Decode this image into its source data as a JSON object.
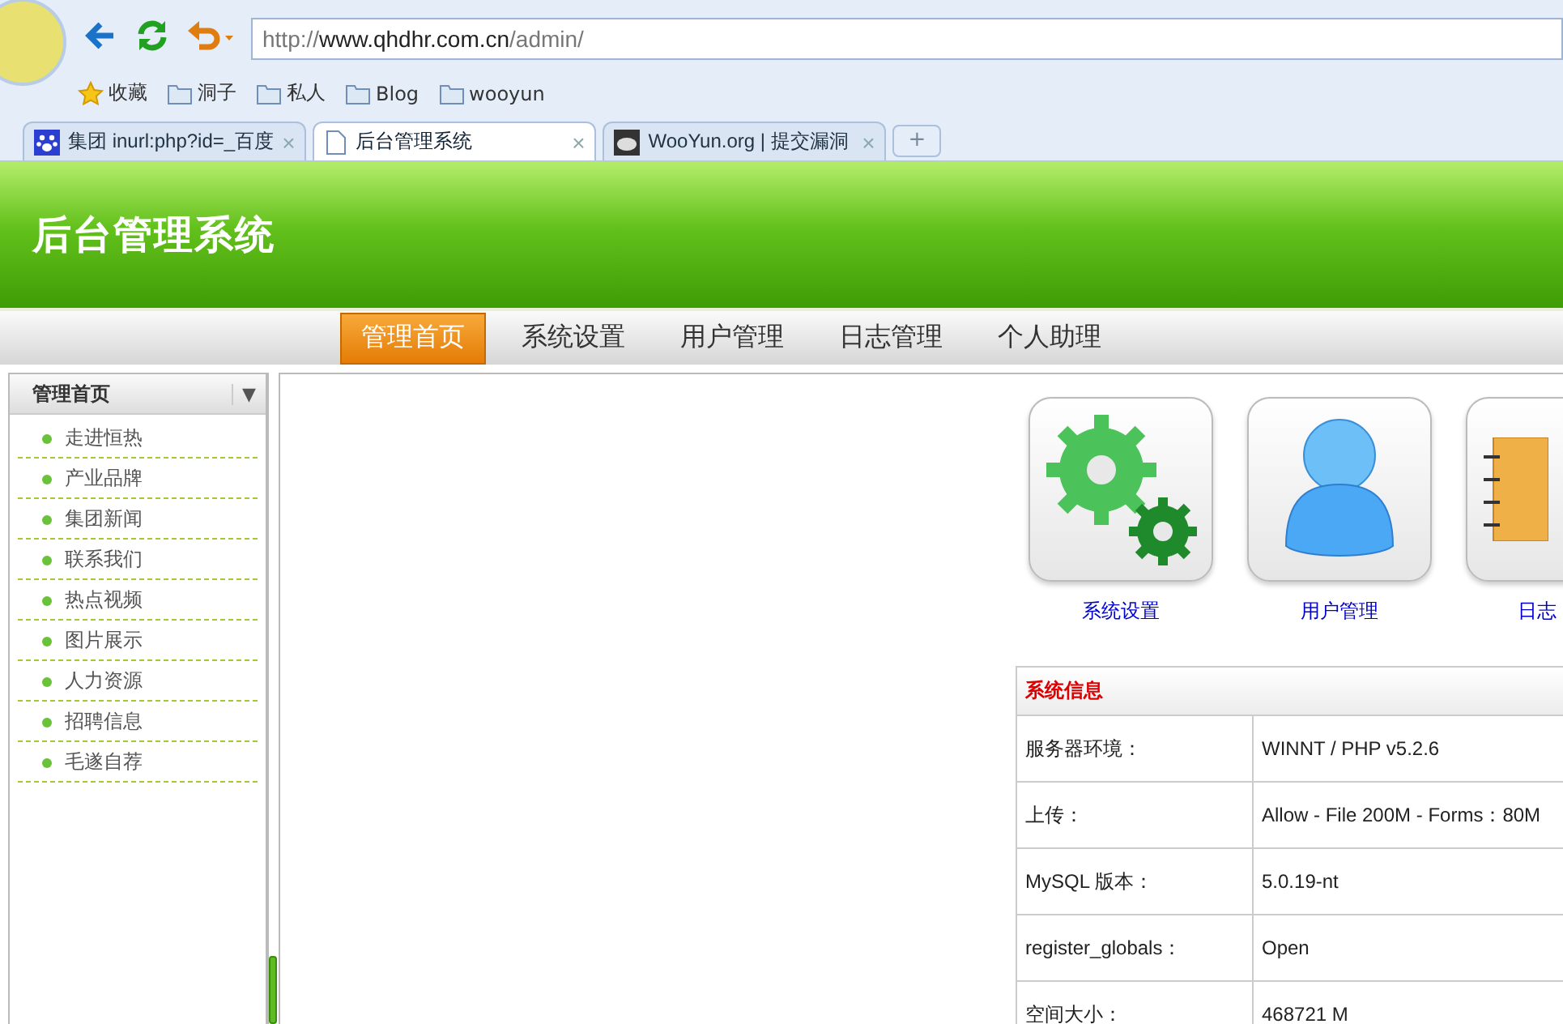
{
  "browser": {
    "address": {
      "scheme": "http://",
      "host": "www.qhdhr.com.cn",
      "path": "/admin/"
    },
    "bookmarks": [
      {
        "label": "收藏",
        "kind": "star"
      },
      {
        "label": "洞子",
        "kind": "folder"
      },
      {
        "label": "私人",
        "kind": "folder"
      },
      {
        "label": "Blog",
        "kind": "folder"
      },
      {
        "label": "wooyun",
        "kind": "folder"
      }
    ],
    "tabs": [
      {
        "label": "集团 inurl:php?id=_百度",
        "kind": "paw",
        "selected": false,
        "close": "×"
      },
      {
        "label": "后台管理系统",
        "kind": "page",
        "selected": true,
        "close": "×"
      },
      {
        "label": "WooYun.org | 提交漏洞",
        "kind": "logo",
        "selected": false,
        "close": "×"
      }
    ],
    "new_tab": "+"
  },
  "site_title": "后台管理系统",
  "nav": [
    {
      "label": "管理首页",
      "selected": true
    },
    {
      "label": "系统设置",
      "selected": false
    },
    {
      "label": "用户管理",
      "selected": false
    },
    {
      "label": "日志管理",
      "selected": false
    },
    {
      "label": "个人助理",
      "selected": false
    }
  ],
  "sidebar": {
    "title": "管理首页",
    "toggle": "▼",
    "items": [
      "走进恒热",
      "产业品牌",
      "集团新闻",
      "联系我们",
      "热点视频",
      "图片展示",
      "人力资源",
      "招聘信息",
      "毛遂自荐"
    ]
  },
  "shortcuts": [
    {
      "label": "系统设置",
      "kind": "gears"
    },
    {
      "label": "用户管理",
      "kind": "user"
    },
    {
      "label": "日志",
      "kind": "notebook"
    }
  ],
  "sys_info": {
    "title": "系统信息",
    "rows": [
      {
        "label": "服务器环境：",
        "value": "WINNT / PHP v5.2.6"
      },
      {
        "label": "上传：",
        "value": "Allow - File 200M - Forms：80M"
      },
      {
        "label": "MySQL 版本：",
        "value": "5.0.19-nt"
      },
      {
        "label": "register_globals：",
        "value": "Open"
      },
      {
        "label": "空间大小：",
        "value": "468721 M"
      }
    ]
  }
}
